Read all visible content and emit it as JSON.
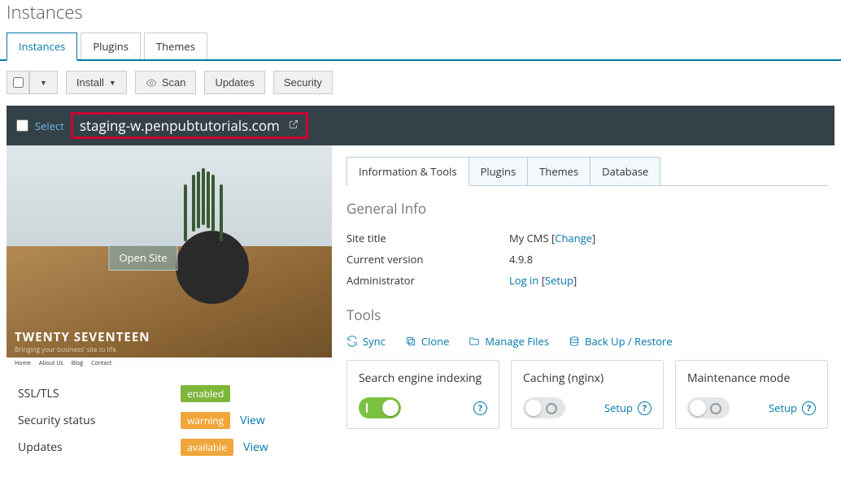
{
  "page_title": "Instances",
  "main_tabs": {
    "items": [
      "Instances",
      "Plugins",
      "Themes"
    ],
    "active": 0
  },
  "actions": {
    "install": "Install",
    "scan": "Scan",
    "updates": "Updates",
    "security": "Security"
  },
  "instance": {
    "select_label": "Select",
    "url": "staging-w.penpubtutorials.com",
    "preview": {
      "open_site": "Open Site",
      "caption_main": "TWENTY SEVENTEEN",
      "caption_sub": "Bringing your business' site to life",
      "nav": [
        "Home",
        "About Us",
        "Blog",
        "Contact"
      ]
    },
    "status": {
      "ssl_label": "SSL/TLS",
      "ssl_badge": "enabled",
      "sec_label": "Security status",
      "sec_badge": "warning",
      "sec_view": "View",
      "upd_label": "Updates",
      "upd_badge": "available",
      "upd_view": "View"
    }
  },
  "detail": {
    "tabs": {
      "items": [
        "Information & Tools",
        "Plugins",
        "Themes",
        "Database"
      ],
      "active": 0
    },
    "general": {
      "heading": "General Info",
      "site_title_label": "Site title",
      "site_title_val": "My CMS",
      "change": "Change",
      "version_label": "Current version",
      "version_val": "4.9.8",
      "admin_label": "Administrator",
      "login": "Log in",
      "setup": "Setup"
    },
    "tools": {
      "heading": "Tools",
      "sync": "Sync",
      "clone": "Clone",
      "manage": "Manage Files",
      "backup": "Back Up / Restore"
    },
    "cards": {
      "search": {
        "title": "Search engine indexing",
        "on": true
      },
      "cache": {
        "title": "Caching (nginx)",
        "on": false,
        "setup": "Setup"
      },
      "maint": {
        "title": "Maintenance mode",
        "on": false,
        "setup": "Setup"
      }
    }
  }
}
